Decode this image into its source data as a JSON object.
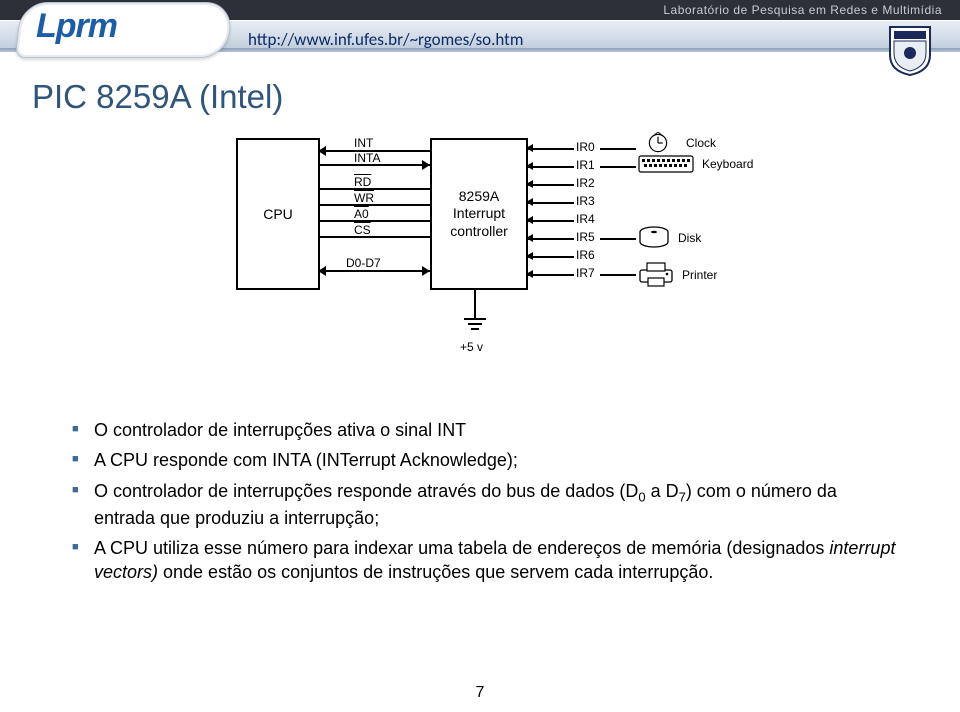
{
  "header": {
    "lab": "Laboratório de Pesquisa em Redes e Multimídia",
    "logo": "Lprm",
    "url": "http://www.inf.ufes.br/~rgomes/so.htm"
  },
  "title": "PIC 8259A (Intel)",
  "diagram": {
    "cpu": "CPU",
    "pic_top": "8259A",
    "pic_mid": "Interrupt",
    "pic_bot": "controller",
    "signals": {
      "int": "INT",
      "inta": "INTA",
      "rd": "RD",
      "wr": "WR",
      "a0": "A0",
      "cs": "CS",
      "data": "D0-D7",
      "plus5v": "+5 v"
    },
    "irq": [
      "IR0",
      "IR1",
      "IR2",
      "IR3",
      "IR4",
      "IR5",
      "IR6",
      "IR7"
    ],
    "devices": {
      "clock": "Clock",
      "keyboard": "Keyboard",
      "disk": "Disk",
      "printer": "Printer"
    }
  },
  "bullets": {
    "b1": "O controlador de interrupções ativa o sinal INT",
    "b2a": "A CPU responde com INTA (",
    "b2b": "INT",
    "b2c": "errupt ",
    "b2d": "A",
    "b2e": "cknowledge);",
    "b3a": "O controlador de interrupções responde através do bus de dados (D",
    "b3b": "0",
    "b3c": " a D",
    "b3d": "7",
    "b3e": ") com o número da entrada que produziu a interrupção;",
    "b4a": "A CPU utiliza esse número para indexar uma tabela de endereços de memória (designados ",
    "b4b": "interrupt vectors)",
    "b4c": " onde estão os conjuntos de instruções que servem cada interrupção."
  },
  "page": "7"
}
